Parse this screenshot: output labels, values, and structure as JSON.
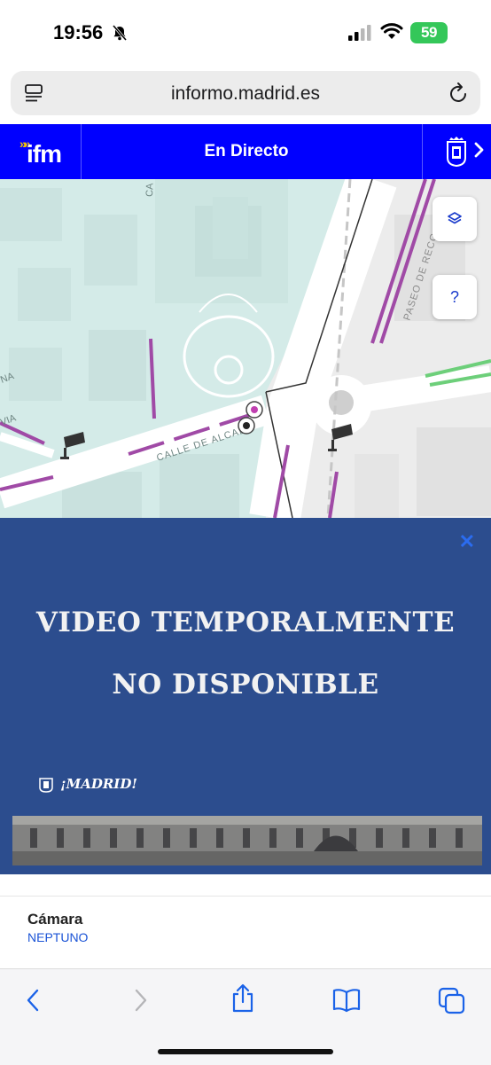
{
  "status_bar": {
    "time": "19:56",
    "battery": "59"
  },
  "browser": {
    "url": "informo.madrid.es"
  },
  "app_header": {
    "logo": "ifm",
    "section_title": "En Directo"
  },
  "map": {
    "street_labels": [
      "CALLE DE ALCALÁ",
      "PASEO DE RECO",
      "NA",
      "VIA",
      "CA"
    ],
    "help_button": "?"
  },
  "video": {
    "line1": "VIDEO TEMPORALMENTE",
    "line2": "NO DISPONIBLE",
    "brand": "¡MADRID!"
  },
  "camera_info": {
    "label": "Cámara",
    "value": "NEPTUNO"
  },
  "colors": {
    "brand_blue": "#0000ff",
    "video_bg": "#2c4d8e",
    "link_blue": "#1a53d6",
    "bus_lane": "#a04aa6"
  }
}
